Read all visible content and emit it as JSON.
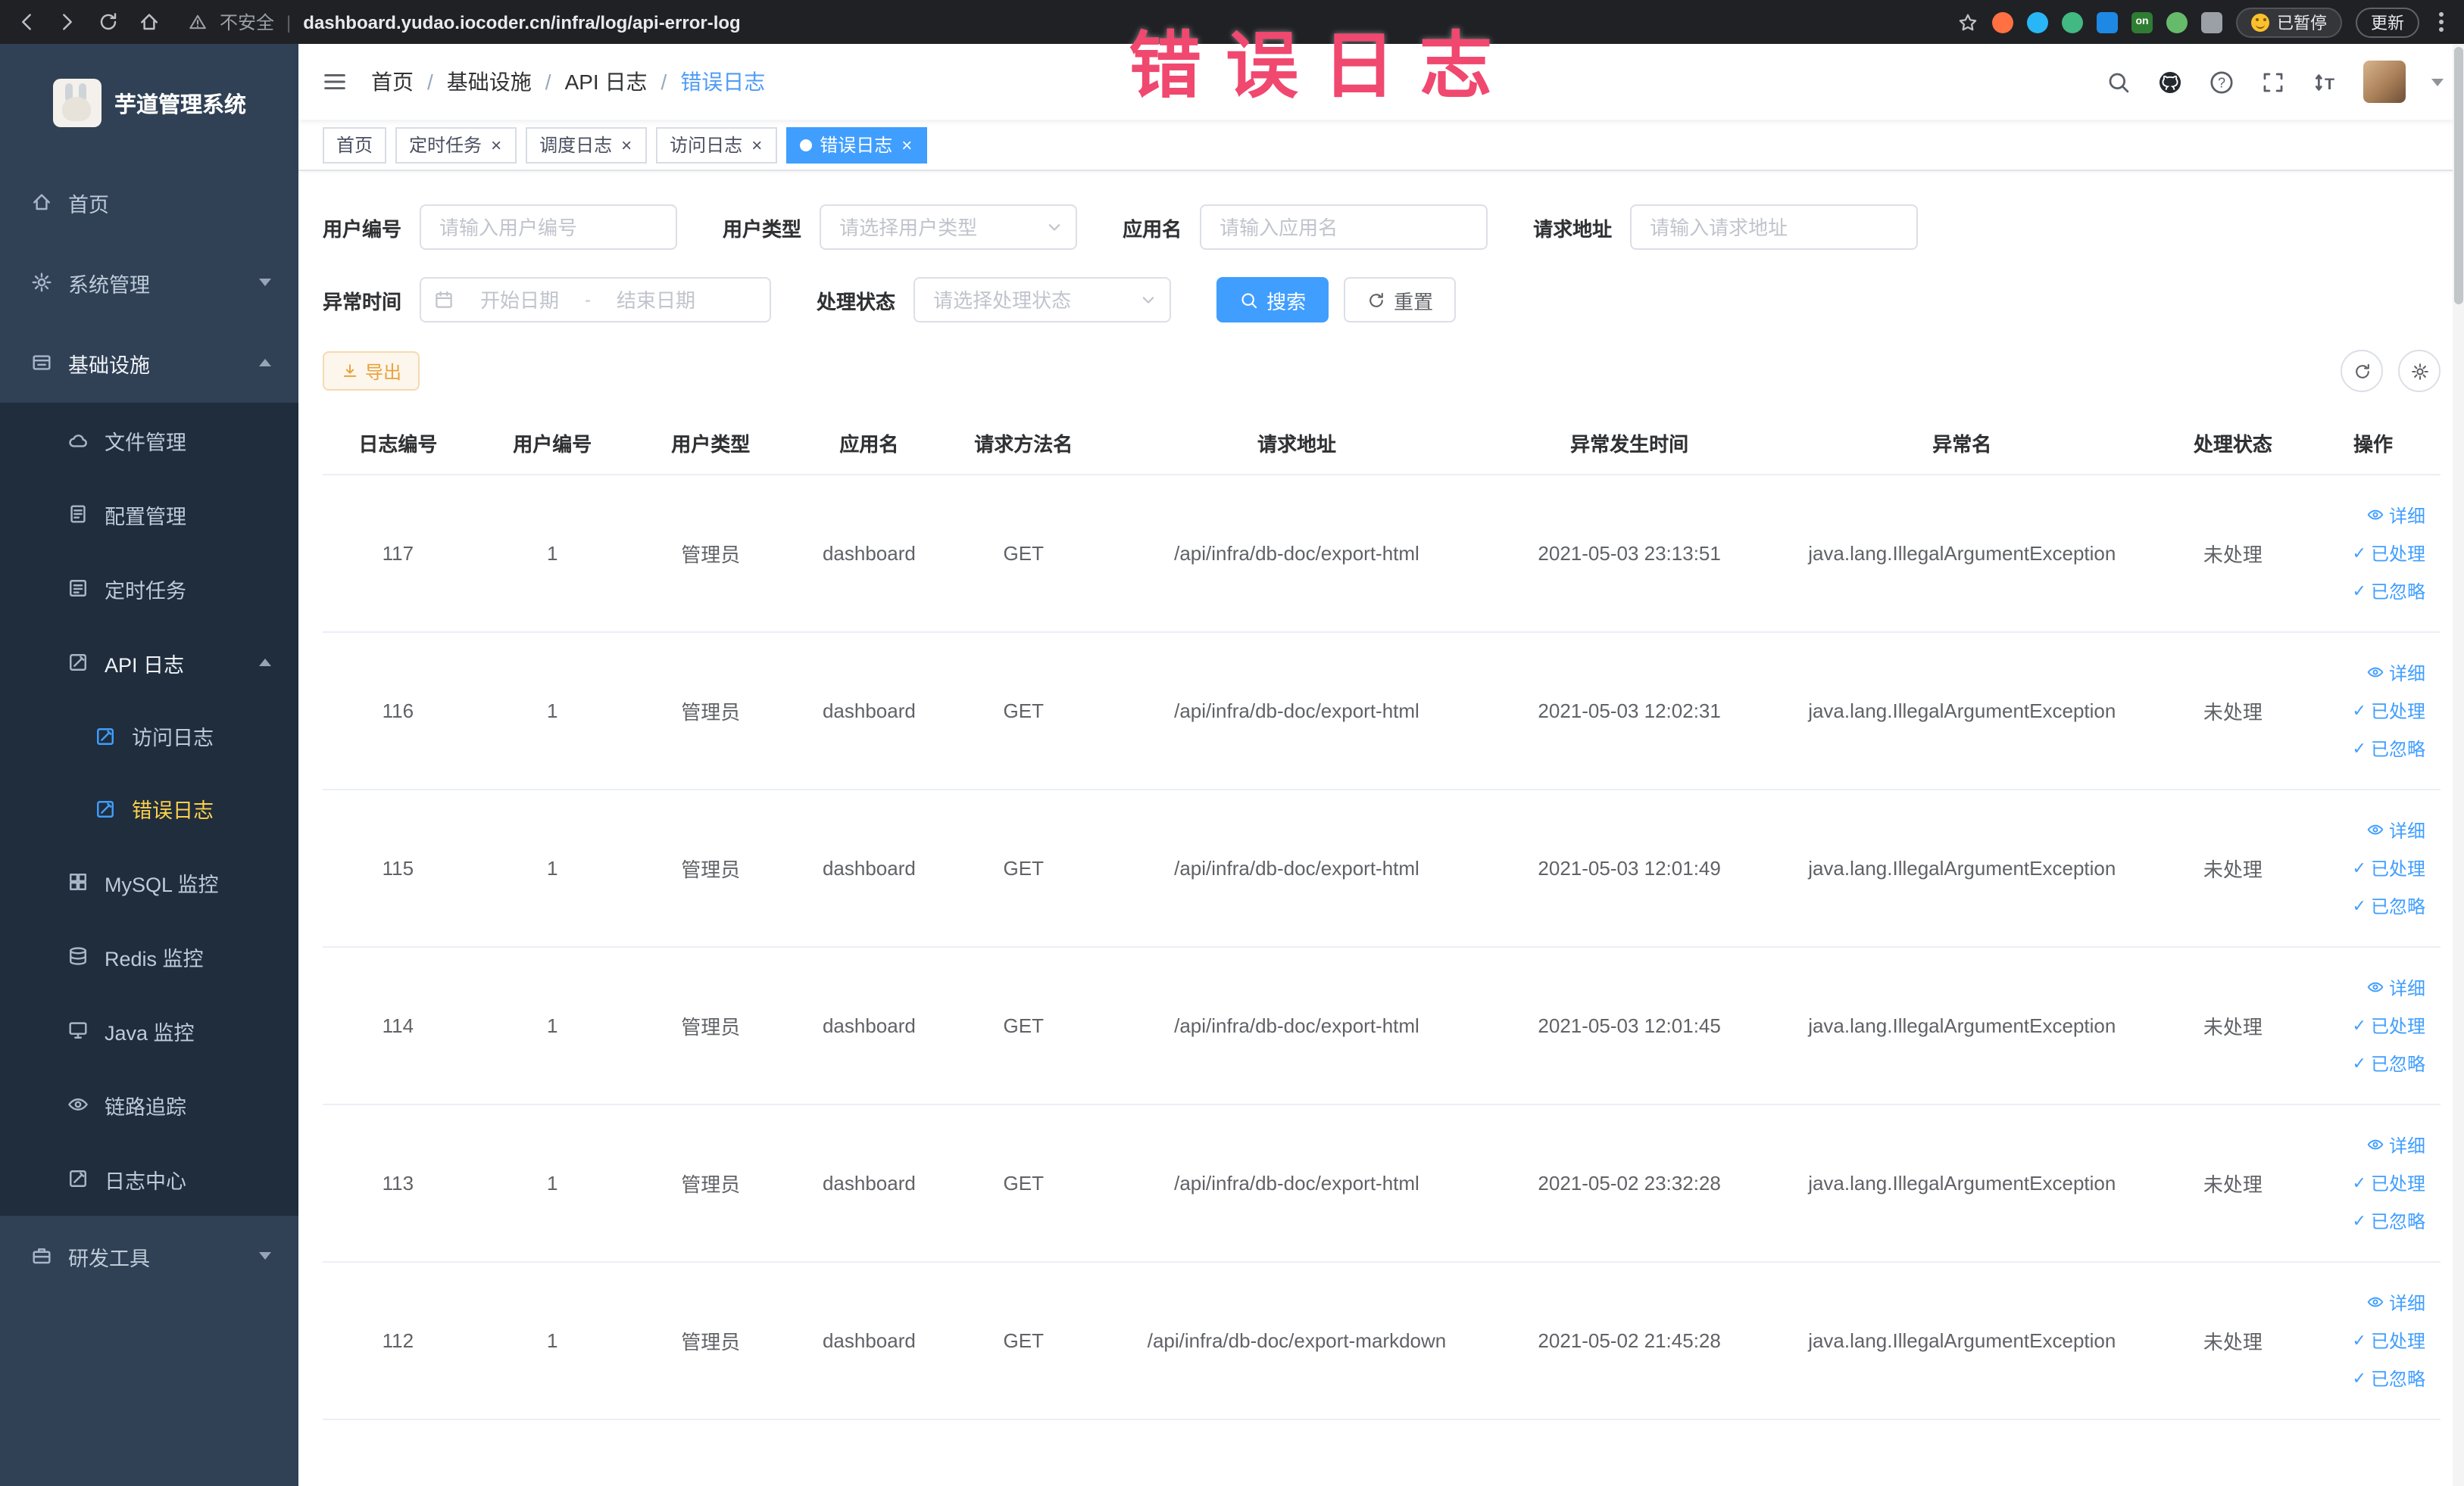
{
  "colors": {
    "accent": "#409eff",
    "annotation": "#f0486f",
    "sidebar_bg": "#304156",
    "submenu_bg": "#1f2d3d",
    "active_menu_text": "#ffd04b",
    "warning": "#e6a23c"
  },
  "icons": {
    "close": "×",
    "pipe": "|",
    "check": "✓",
    "question": "?",
    "font_size": "T",
    "on": "on",
    "slash": "/"
  },
  "browser": {
    "security_label": "不安全",
    "url": "dashboard.yudao.iocoder.cn/infra/log/api-error-log",
    "paused_badge": "已暂停",
    "update_label": "更新"
  },
  "annotation": {
    "text": "错误日志"
  },
  "sidebar": {
    "logo_title": "芋道管理系统",
    "items": {
      "home": "首页",
      "system": "系统管理",
      "infra": "基础设施",
      "file": "文件管理",
      "config": "配置管理",
      "job": "定时任务",
      "api_log": "API 日志",
      "access_log": "访问日志",
      "error_log": "错误日志",
      "mysql": "MySQL 监控",
      "redis": "Redis 监控",
      "java": "Java 监控",
      "trace": "链路追踪",
      "log_center": "日志中心",
      "dev_tools": "研发工具"
    }
  },
  "breadcrumb": {
    "items": [
      "首页",
      "基础设施",
      "API 日志",
      "错误日志"
    ]
  },
  "tabs": [
    {
      "label": "首页",
      "closable": false,
      "active": false
    },
    {
      "label": "定时任务",
      "closable": true,
      "active": false
    },
    {
      "label": "调度日志",
      "closable": true,
      "active": false
    },
    {
      "label": "访问日志",
      "closable": true,
      "active": false
    },
    {
      "label": "错误日志",
      "closable": true,
      "active": true
    }
  ],
  "filters": {
    "user_id": {
      "label": "用户编号",
      "placeholder": "请输入用户编号",
      "value": ""
    },
    "user_type": {
      "label": "用户类型",
      "placeholder": "请选择用户类型",
      "value": ""
    },
    "app_name": {
      "label": "应用名",
      "placeholder": "请输入应用名",
      "value": ""
    },
    "request_url": {
      "label": "请求地址",
      "placeholder": "请输入请求地址",
      "value": ""
    },
    "exception_time": {
      "label": "异常时间",
      "start_placeholder": "开始日期",
      "separator": "-",
      "end_placeholder": "结束日期"
    },
    "process_status": {
      "label": "处理状态",
      "placeholder": "请选择处理状态",
      "value": ""
    },
    "search_label": "搜索",
    "reset_label": "重置"
  },
  "toolbar": {
    "export_label": "导出"
  },
  "table": {
    "columns": [
      "日志编号",
      "用户编号",
      "用户类型",
      "应用名",
      "请求方法名",
      "请求地址",
      "异常发生时间",
      "异常名",
      "处理状态",
      "操作"
    ],
    "row_actions": [
      "详细",
      "已处理",
      "已忽略"
    ],
    "rows": [
      {
        "log_id": "117",
        "user_id": "1",
        "user_type": "管理员",
        "app_name": "dashboard",
        "method": "GET",
        "url": "/api/infra/db-doc/export-html",
        "time": "2021-05-03 23:13:51",
        "exception": "java.lang.IllegalArgumentException",
        "status": "未处理"
      },
      {
        "log_id": "116",
        "user_id": "1",
        "user_type": "管理员",
        "app_name": "dashboard",
        "method": "GET",
        "url": "/api/infra/db-doc/export-html",
        "time": "2021-05-03 12:02:31",
        "exception": "java.lang.IllegalArgumentException",
        "status": "未处理"
      },
      {
        "log_id": "115",
        "user_id": "1",
        "user_type": "管理员",
        "app_name": "dashboard",
        "method": "GET",
        "url": "/api/infra/db-doc/export-html",
        "time": "2021-05-03 12:01:49",
        "exception": "java.lang.IllegalArgumentException",
        "status": "未处理"
      },
      {
        "log_id": "114",
        "user_id": "1",
        "user_type": "管理员",
        "app_name": "dashboard",
        "method": "GET",
        "url": "/api/infra/db-doc/export-html",
        "time": "2021-05-03 12:01:45",
        "exception": "java.lang.IllegalArgumentException",
        "status": "未处理"
      },
      {
        "log_id": "113",
        "user_id": "1",
        "user_type": "管理员",
        "app_name": "dashboard",
        "method": "GET",
        "url": "/api/infra/db-doc/export-html",
        "time": "2021-05-02 23:32:28",
        "exception": "java.lang.IllegalArgumentException",
        "status": "未处理"
      },
      {
        "log_id": "112",
        "user_id": "1",
        "user_type": "管理员",
        "app_name": "dashboard",
        "method": "GET",
        "url": "/api/infra/db-doc/export-markdown",
        "time": "2021-05-02 21:45:28",
        "exception": "java.lang.IllegalArgumentException",
        "status": "未处理"
      }
    ]
  }
}
